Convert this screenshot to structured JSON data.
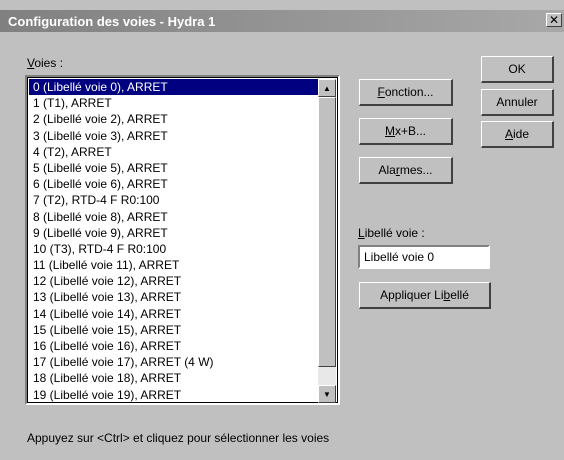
{
  "window": {
    "title": "Configuration des voies - Hydra 1",
    "close_glyph": "✕"
  },
  "voies": {
    "label_pre": "",
    "label_ul": "V",
    "label_post": "oies :",
    "items": [
      "0 (Libellé voie 0),  ARRET",
      "1 (T1),  ARRET",
      "2 (Libellé voie 2),  ARRET",
      "3 (Libellé voie 3),  ARRET",
      "4 (T2),  ARRET",
      "5 (Libellé voie 5),  ARRET",
      "6 (Libellé voie 6),  ARRET",
      "7 (T2),  RTD-4 F  R0:100",
      "8 (Libellé voie 8),  ARRET",
      "9 (Libellé voie 9),  ARRET",
      "10 (T3),  RTD-4 F  R0:100",
      "11 (Libellé voie 11),  ARRET",
      "12 (Libellé voie 12),  ARRET",
      "13 (Libellé voie 13),  ARRET",
      "14 (Libellé voie 14),  ARRET",
      "15 (Libellé voie 15),  ARRET",
      "16 (Libellé voie 16),  ARRET",
      "17 (Libellé voie 17),  ARRET (4 W)",
      "18 (Libellé voie 18),  ARRET",
      "19 (Libellé voie 19),  ARRET"
    ],
    "selected_index": 0
  },
  "buttons": {
    "fonction": {
      "pre": "",
      "ul": "F",
      "post": "onction..."
    },
    "mxb": {
      "pre": "",
      "ul": "M",
      "post": "x+B..."
    },
    "alarmes": {
      "pre": "Ala",
      "ul": "r",
      "post": "mes..."
    },
    "ok": {
      "label": "OK"
    },
    "annuler": {
      "label": "Annuler"
    },
    "aide": {
      "pre": "",
      "ul": "A",
      "post": "ide"
    },
    "appliquer": {
      "pre": "Appliquer Li",
      "ul": "b",
      "post": "ellé"
    }
  },
  "libelle": {
    "label_pre": "",
    "label_ul": "L",
    "label_post": "ibellé voie :",
    "value": "Libellé voie 0"
  },
  "footer": {
    "hint": "Appuyez sur <Ctrl> et cliquez pour sélectionner les voies"
  }
}
